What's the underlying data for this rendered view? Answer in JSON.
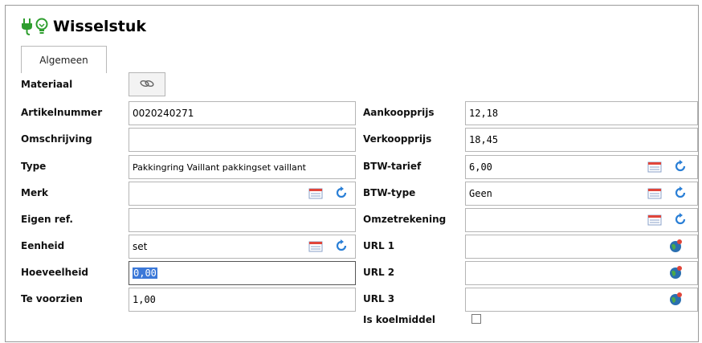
{
  "title": "Wisselstuk",
  "tabs": [
    {
      "label": "Algemeen"
    }
  ],
  "left": {
    "materiaal": {
      "label": "Materiaal"
    },
    "artikelnummer": {
      "label": "Artikelnummer",
      "value": "0020240271"
    },
    "omschrijving": {
      "label": "Omschrijving",
      "value": ""
    },
    "type": {
      "label": "Type",
      "value": "Pakkingring Vaillant  pakkingset vaillant"
    },
    "merk": {
      "label": "Merk",
      "value": ""
    },
    "eigen_ref": {
      "label": "Eigen ref.",
      "value": ""
    },
    "eenheid": {
      "label": "Eenheid",
      "value": "set"
    },
    "hoeveelheid": {
      "label": "Hoeveelheid",
      "value": "0,00"
    },
    "te_voorzien": {
      "label": "Te voorzien",
      "value": "1,00"
    }
  },
  "right": {
    "aankoopprijs": {
      "label": "Aankoopprijs",
      "value": "12,18"
    },
    "verkoopprijs": {
      "label": "Verkoopprijs",
      "value": "18,45"
    },
    "btw_tarief": {
      "label": "BTW-tarief",
      "value": "6,00"
    },
    "btw_type": {
      "label": "BTW-type",
      "value": "Geen"
    },
    "omzetrekening": {
      "label": "Omzetrekening",
      "value": ""
    },
    "url1": {
      "label": "URL 1",
      "value": ""
    },
    "url2": {
      "label": "URL 2",
      "value": ""
    },
    "url3": {
      "label": "URL 3",
      "value": ""
    },
    "is_koelmiddel": {
      "label": "Is koelmiddel",
      "checked": false
    }
  },
  "colors": {
    "plug": "#2e9e2e",
    "selection": "#3b78d8",
    "list_icon_red": "#e0453a",
    "refresh_blue": "#2a7fd6",
    "globe": "#2a6fb0"
  }
}
